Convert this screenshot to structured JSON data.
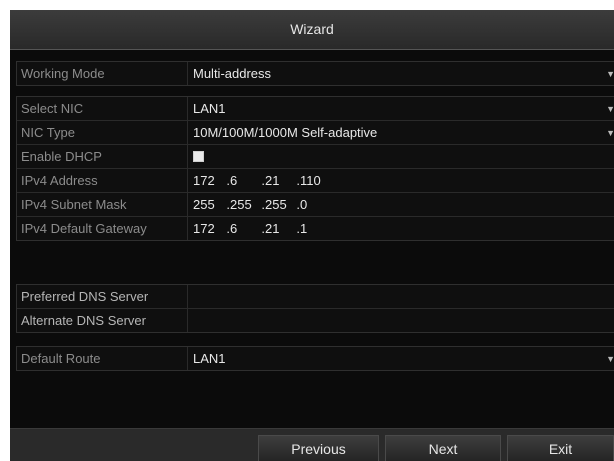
{
  "window": {
    "title": "Wizard"
  },
  "form": {
    "working_mode": {
      "label": "Working Mode",
      "value": "Multi-address"
    },
    "select_nic": {
      "label": "Select NIC",
      "value": "LAN1"
    },
    "nic_type": {
      "label": "NIC Type",
      "value": "10M/100M/1000M Self-adaptive"
    },
    "enable_dhcp": {
      "label": "Enable DHCP",
      "checked": false
    },
    "ipv4_address": {
      "label": "IPv4 Address",
      "octets": [
        "172",
        "6",
        "21",
        "110"
      ]
    },
    "ipv4_subnet_mask": {
      "label": "IPv4 Subnet Mask",
      "octets": [
        "255",
        "255",
        "255",
        "0"
      ]
    },
    "ipv4_default_gateway": {
      "label": "IPv4 Default Gateway",
      "octets": [
        "172",
        "6",
        "21",
        "1"
      ]
    },
    "preferred_dns": {
      "label": "Preferred DNS Server",
      "value": ""
    },
    "alternate_dns": {
      "label": "Alternate DNS Server",
      "value": ""
    },
    "default_route": {
      "label": "Default Route",
      "value": "LAN1"
    }
  },
  "footer": {
    "previous_label": "Previous",
    "next_label": "Next",
    "exit_label": "Exit"
  },
  "icons": {
    "dropdown": "chevron-down-icon"
  },
  "colors": {
    "background": "#0b0b0b",
    "titlebar": "#333333",
    "text": "#e8e8e8",
    "label": "#8c8c8c"
  }
}
